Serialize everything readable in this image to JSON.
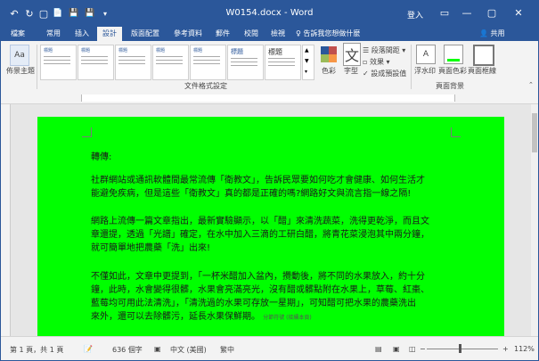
{
  "titlebar": {
    "title": "W0154.docx - Word",
    "login": "登入",
    "quick_access": [
      "↶",
      "↻",
      "▢",
      "📄",
      "💾",
      "💾",
      "▾"
    ],
    "window_buttons": [
      "▭",
      "—",
      "▢",
      "✕"
    ]
  },
  "tabs": [
    "檔案",
    "常用",
    "插入",
    "設計",
    "版面配置",
    "參考資料",
    "郵件",
    "校閱",
    "檢視"
  ],
  "active_tab": "設計",
  "tellme": "♀ 告訴我您想做什麼",
  "share": "共用",
  "ribbon": {
    "theme_label": "佈景主題",
    "gallery_group_label": "文件格式設定",
    "gallery_items": [
      "標題",
      "標題",
      "標題",
      "標題",
      "標題",
      "標題",
      "標題",
      "標題"
    ],
    "colors_label": "色彩",
    "fonts_label": "字型",
    "fonts_icon": "文",
    "paragraph_spacing": "段落間距 ▾",
    "effects": "效果 ▾",
    "set_default": "設成預設值",
    "watermark": "浮水印",
    "page_color": "頁面色彩",
    "page_borders": "頁面框線",
    "background_group_label": "頁面背景"
  },
  "document": {
    "heading": "轉傳:",
    "paragraphs": [
      [
        "社群網站或通訊軟體間最常流傳「衛教文」，告訴民眾要如何吃才會健康、如何生活才",
        "能避免疾病，但是這些「衛教文」真的都是正確的嗎?網路好文與流言指一線之隔!"
      ],
      [
        "網路上流傳一篇文章指出，最新實驗顯示，以「醋」來清洗蔬菜，洗得更乾淨，而且文",
        "章還提，透過「光譜」確定，在水中加入三滴的工研白醋，將青花菜浸泡其中兩分鐘，",
        "就可簡單地把農藥「洗」出來!"
      ],
      [
        "不僅如此，文章中更提到，「一杯米醋加入盆內，攪動後，將不同的水果放入，約十分",
        "鐘，此時，水會變得很髒，水果會亮滿亮光，沒有醋或髒點附在水果上，草莓、紅棗、",
        "藍莓均可用此法清洗」，「清洗過的水果可存放一星期」，可知醋可把水果的農藥洗出",
        "來外，還可以去除髒污，延長水果保鮮期。"
      ]
    ],
    "section_break": "分節符號 (接續本頁)"
  },
  "status": {
    "page": "第 1 頁，共 1 頁",
    "words": "636 個字",
    "proofing_icon": "▣",
    "language": "中文 (美國)",
    "view_mode": "繁中",
    "zoom": "112%",
    "zoom_minus": "−",
    "zoom_plus": "+"
  }
}
